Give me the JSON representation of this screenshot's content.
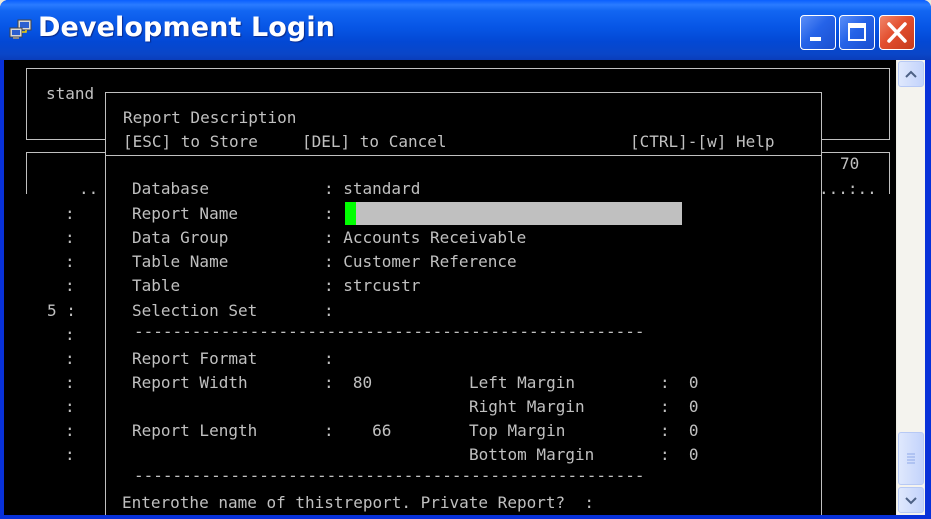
{
  "window": {
    "title": "Development Login",
    "icon": "terminal-network-icon",
    "colors": {
      "titlebar": "#0a52e0",
      "close": "#e04d2c",
      "terminal_bg": "#000000",
      "terminal_fg": "#c0c0c0",
      "cursor": "#00ff00"
    }
  },
  "background": {
    "stand": "stand",
    "col70": "70",
    "ruler": "...:..",
    "dots": "..",
    "gutter": [
      ":",
      ":",
      ":",
      ":",
      "5 :",
      ":",
      ":",
      ":",
      ":",
      ":",
      ":"
    ]
  },
  "dialog": {
    "title": "Report Description",
    "hint_store": "[ESC] to Store",
    "hint_cancel": "[DEL] to Cancel",
    "hint_help": "[CTRL]-[w] Help",
    "fields": {
      "database": {
        "label": "Database",
        "value": ": standard"
      },
      "report_name": {
        "label": "Report Name",
        "value": ":"
      },
      "data_group": {
        "label": "Data Group",
        "value": ": Accounts Receivable"
      },
      "table_name": {
        "label": "Table Name",
        "value": ": Customer Reference"
      },
      "table": {
        "label": "Table",
        "value": ": strcustr"
      },
      "selection_set": {
        "label": "Selection Set",
        "value": ":"
      }
    },
    "format": {
      "report_format": {
        "label": "Report Format",
        "value": ":"
      },
      "report_width": {
        "label": "Report Width",
        "value": ":  80"
      },
      "report_length": {
        "label": "Report Length",
        "value": ":    66"
      },
      "left_margin": {
        "label": "Left Margin",
        "value": ":  0"
      },
      "right_margin": {
        "label": "Right Margin",
        "value": ":  0"
      },
      "top_margin": {
        "label": "Top Margin",
        "value": ":  0"
      },
      "bottom_margin": {
        "label": "Bottom Margin",
        "value": ":  0"
      }
    },
    "separator": "-----------------------------------------------------",
    "status": "Enterothe name of thistreport. Private Report?  :"
  }
}
